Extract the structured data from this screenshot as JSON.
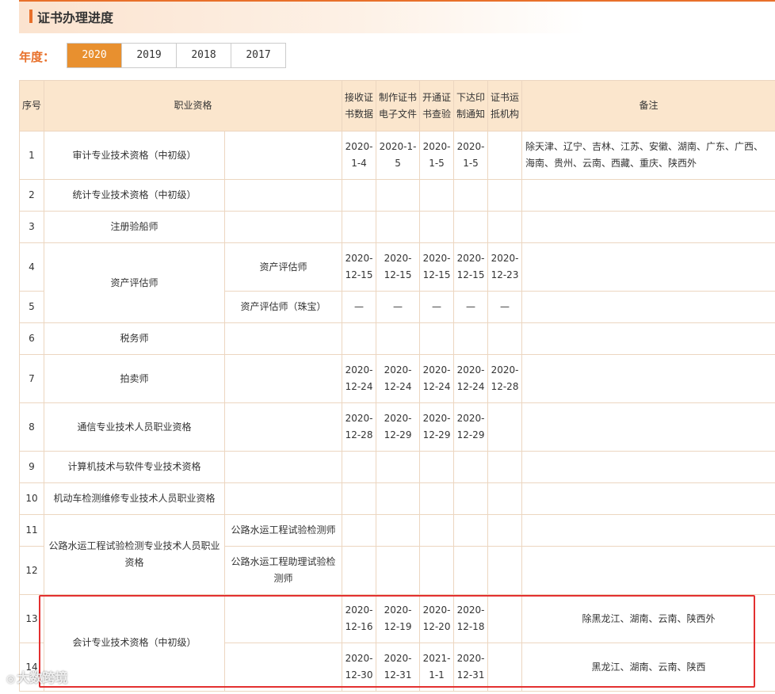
{
  "page": {
    "title": "证书办理进度"
  },
  "year": {
    "label": "年度：",
    "tabs": [
      "2020",
      "2019",
      "2018",
      "2017"
    ],
    "active": "2020"
  },
  "table": {
    "headers": {
      "no": "序号",
      "qual": "职业资格",
      "c1a": "接收证",
      "c1b": "书数据",
      "c2a": "制作证书",
      "c2b": "电子文件",
      "c3a": "开通证",
      "c3b": "书查验",
      "c4a": "下达印",
      "c4b": "制通知",
      "c5a": "证书运",
      "c5b": "抵机构",
      "note": "备注"
    },
    "rows": [
      {
        "no": "1",
        "qual": "审计专业技术资格（中初级）",
        "sub": "",
        "d1": [
          "2020-",
          "1-4"
        ],
        "d2": [
          "2020-1-",
          "5"
        ],
        "d3": [
          "2020-",
          "1-5"
        ],
        "d4": [
          "2020-",
          "1-5"
        ],
        "d5": [
          "",
          ""
        ],
        "note": "除天津、辽宁、吉林、江苏、安徽、湖南、广东、广西、海南、贵州、云南、西藏、重庆、陕西外"
      },
      {
        "no": "2",
        "qual": "统计专业技术资格（中初级）",
        "sub": ""
      },
      {
        "no": "3",
        "qual": "注册验船师",
        "sub": ""
      },
      {
        "no": "4",
        "qual": "资产评估师",
        "sub": "资产评估师",
        "d1": [
          "2020-",
          "12-15"
        ],
        "d2": [
          "2020-",
          "12-15"
        ],
        "d3": [
          "2020-",
          "12-15"
        ],
        "d4": [
          "2020-",
          "12-15"
        ],
        "d5": [
          "2020-",
          "12-23"
        ],
        "note": ""
      },
      {
        "no": "5",
        "sub": "资产评估师（珠宝）",
        "dash": "—"
      },
      {
        "no": "6",
        "qual": "税务师",
        "sub": ""
      },
      {
        "no": "7",
        "qual": "拍卖师",
        "sub": "",
        "d1": [
          "2020-",
          "12-24"
        ],
        "d2": [
          "2020-",
          "12-24"
        ],
        "d3": [
          "2020-",
          "12-24"
        ],
        "d4": [
          "2020-",
          "12-24"
        ],
        "d5": [
          "2020-",
          "12-28"
        ],
        "note": ""
      },
      {
        "no": "8",
        "qual": "通信专业技术人员职业资格",
        "sub": "",
        "d1": [
          "2020-",
          "12-28"
        ],
        "d2": [
          "2020-",
          "12-29"
        ],
        "d3": [
          "2020-",
          "12-29"
        ],
        "d4": [
          "2020-",
          "12-29"
        ],
        "d5": [
          "",
          ""
        ],
        "note": ""
      },
      {
        "no": "9",
        "qual": "计算机技术与软件专业技术资格",
        "sub": ""
      },
      {
        "no": "10",
        "qual": "机动车检测维修专业技术人员职业资格",
        "sub": ""
      },
      {
        "no": "11",
        "qual": "公路水运工程试验检测专业技术人员职业资格",
        "sub": "公路水运工程试验检测师"
      },
      {
        "no": "12",
        "sub": "公路水运工程助理试验检测师"
      },
      {
        "no": "13",
        "qual": "会计专业技术资格（中初级）",
        "sub": "",
        "d1": [
          "2020-",
          "12-16"
        ],
        "d2": [
          "2020-",
          "12-19"
        ],
        "d3": [
          "2020-",
          "12-20"
        ],
        "d4": [
          "2020-",
          "12-18"
        ],
        "d5": [
          "",
          ""
        ],
        "note": "除黑龙江、湖南、云南、陕西外"
      },
      {
        "no": "14",
        "sub": "",
        "d1": [
          "2020-",
          "12-30"
        ],
        "d2": [
          "2020-",
          "12-31"
        ],
        "d3": [
          "2021-",
          "1-1"
        ],
        "d4": [
          "2020-",
          "12-31"
        ],
        "d5": [
          "",
          ""
        ],
        "note": "黑龙江、湖南、云南、陕西"
      }
    ]
  },
  "watermark": {
    "text": "大数跨境",
    "icon": "camera-icon"
  },
  "colors": {
    "accent": "#e8702a",
    "tab_active": "#e8902f",
    "header_bg": "#fbe6cd",
    "highlight_box": "#e33030"
  }
}
